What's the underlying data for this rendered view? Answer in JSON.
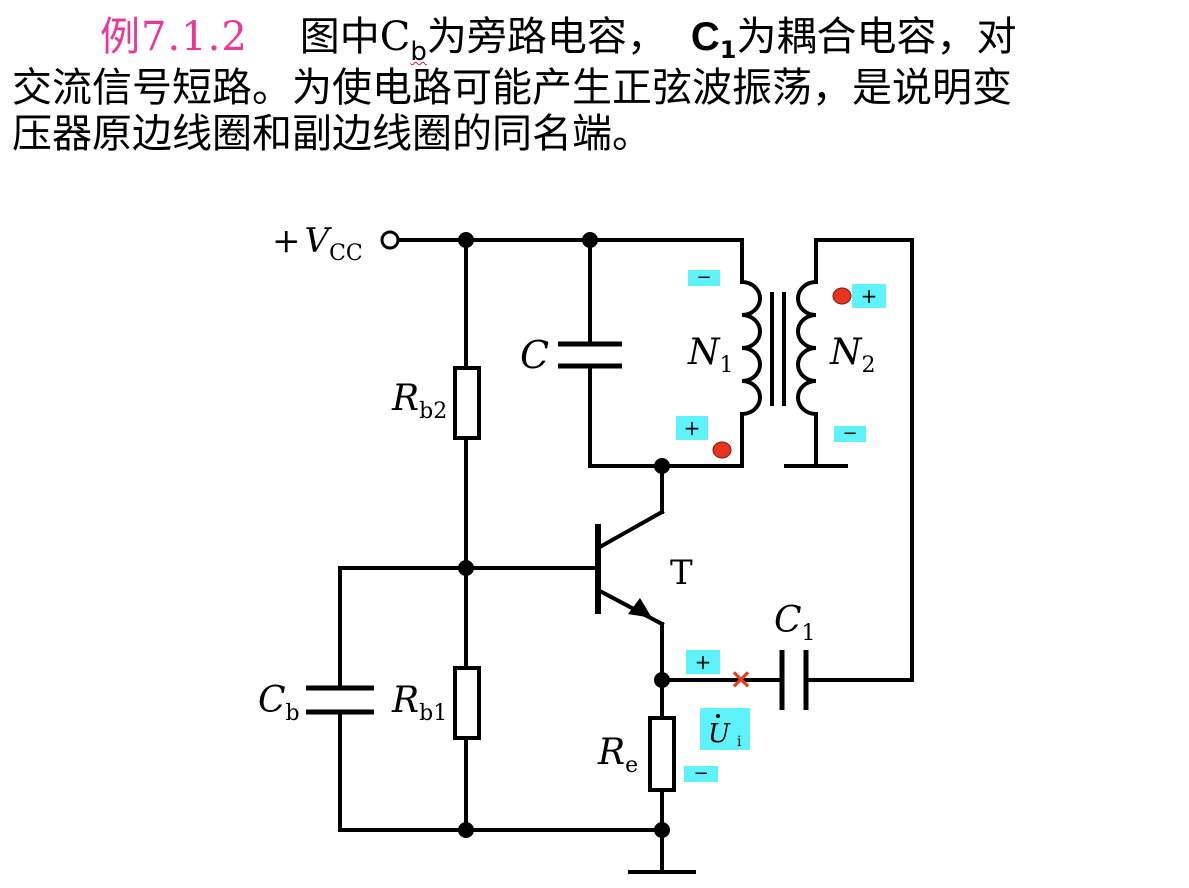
{
  "question": {
    "example_no": "例7.1.2",
    "line1_a": "图中",
    "cb_main": "C",
    "cb_sub": "b",
    "line1_b": "为旁路电容，",
    "c1_main": "C",
    "c1_sub": "1",
    "line1_c": "为耦合电容，对",
    "line2": "交流信号短路。为使电路可能产生正弦波振荡，是说明变",
    "line3": "压器原边线圈和副边线圈的同名端。"
  },
  "circuit": {
    "vcc_plus": "+",
    "vcc_main": "V",
    "vcc_sub": "CC",
    "cap_c": "C",
    "n1_main": "N",
    "n1_sub": "1",
    "n2_main": "N",
    "n2_sub": "2",
    "rb2_main": "R",
    "rb2_sub": "b2",
    "transistor": "T",
    "c1_main": "C",
    "c1_sub": "1",
    "cb_main": "C",
    "cb_sub": "b",
    "rb1_main": "R",
    "rb1_sub": "b1",
    "re_main": "R",
    "re_sub": "e",
    "ui_main": "U",
    "ui_sub": "i"
  },
  "annotations": {
    "n1_top": "−",
    "n2_top": "+",
    "n1_bottom": "+",
    "n2_bottom": "−",
    "emitter_plus": "+",
    "emitter_minus": "−",
    "break_mark": "×"
  },
  "colors": {
    "example_text": "#e8389a",
    "label_bg": "#5ef3fa",
    "dot": "#e8341c",
    "break_mark": "#e8401c"
  }
}
